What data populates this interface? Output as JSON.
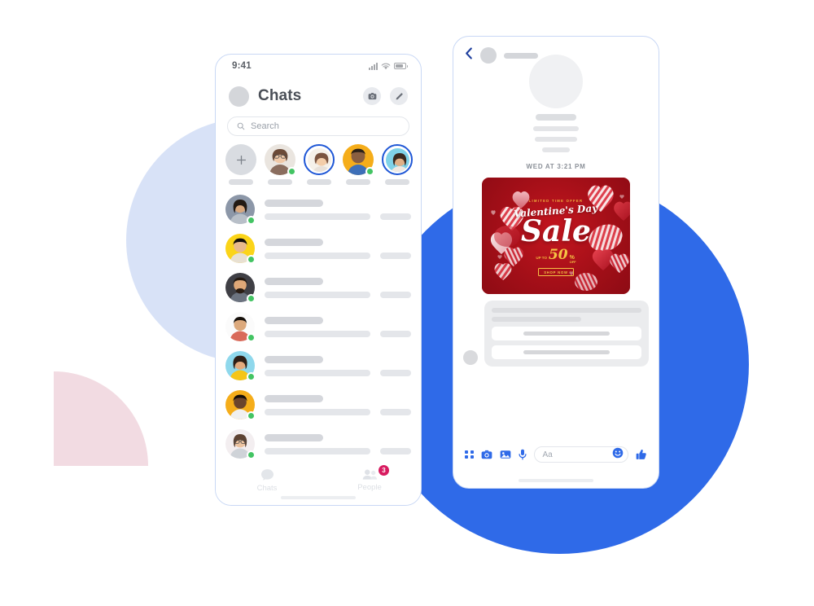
{
  "background": {
    "circle_light_blue": "#d8e2f7",
    "circle_blue": "#2f6ae8",
    "quarter_pink": "#f2dbe2"
  },
  "phone_left": {
    "status_bar": {
      "time": "9:41",
      "icons": [
        "signal-icon",
        "wifi-icon",
        "battery-icon"
      ]
    },
    "header": {
      "title": "Chats",
      "avatar": "profile-avatar",
      "camera_button": "camera-icon",
      "compose_button": "edit-pencil-icon"
    },
    "search": {
      "placeholder": "Search",
      "icon": "search-icon"
    },
    "stories": [
      {
        "type": "add",
        "label": "add-story-button",
        "icon": "plus-icon"
      },
      {
        "type": "avatar",
        "ring": false,
        "online": true,
        "color": "#e9e4e0"
      },
      {
        "type": "avatar",
        "ring": true,
        "online": false,
        "color": "#f2efe9"
      },
      {
        "type": "avatar",
        "ring": false,
        "online": true,
        "color": "#f5ad1a"
      },
      {
        "type": "avatar",
        "ring": true,
        "online": false,
        "color": "#7fd2e8"
      }
    ],
    "chat_rows": [
      {
        "online": true,
        "color": "#8c97a8"
      },
      {
        "online": true,
        "color": "#fbd419"
      },
      {
        "online": true,
        "color": "#3f3f45"
      },
      {
        "online": true,
        "color": "#fbfbfb"
      },
      {
        "online": true,
        "color": "#8fd8ec"
      },
      {
        "online": true,
        "color": "#f5ad1a"
      },
      {
        "online": true,
        "color": "#f3eef0"
      }
    ],
    "tabbar": {
      "tabs": [
        {
          "label": "Chats",
          "icon": "chat-bubble-icon",
          "badge": null
        },
        {
          "label": "People",
          "icon": "people-icon",
          "badge": "3"
        }
      ],
      "badge_color": "#d81b60"
    }
  },
  "phone_right": {
    "header": {
      "back_icon": "back-chevron-icon",
      "avatar": "contact-avatar",
      "name_placeholder": "contact-name-bar"
    },
    "timestamp": "WED AT 3:21 PM",
    "ad": {
      "limited_text": "LIMITED TIME OFFER",
      "valentines_text": "Valentine's Day",
      "sale_text": "Sale",
      "upto_text": "UP TO",
      "discount": "50",
      "percent": "%",
      "off_text": "OFF",
      "cta": "SHOP NOW",
      "bg_color": "#b5121b",
      "accent_color": "#f5c344"
    },
    "composer": {
      "placeholder": "Aa",
      "icons": [
        "apps-grid-icon",
        "camera-icon",
        "gallery-icon",
        "microphone-icon",
        "emoji-icon",
        "thumbs-up-icon"
      ],
      "accent_color": "#2f6ae8"
    }
  }
}
